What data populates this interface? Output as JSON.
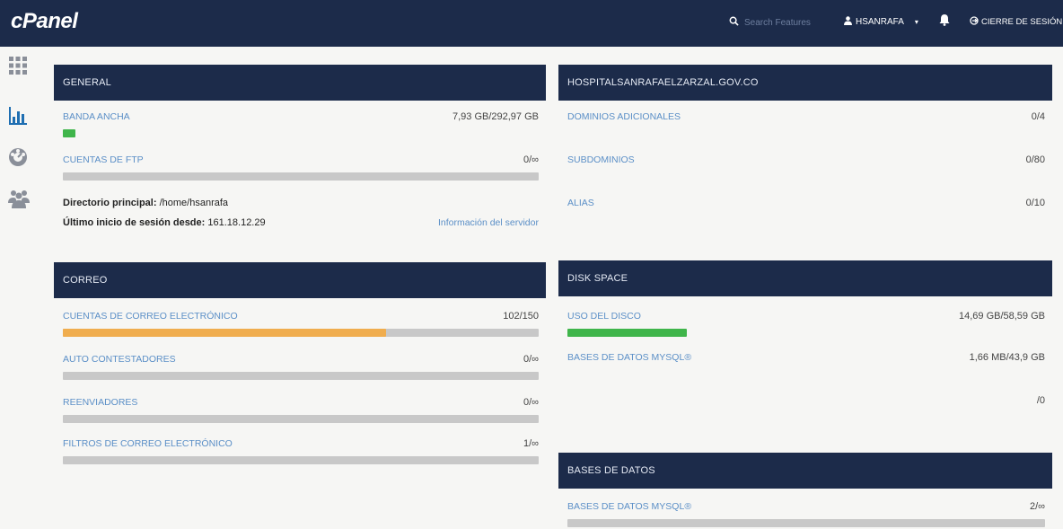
{
  "topbar": {
    "logo": "cPanel",
    "search_placeholder": "Search Features",
    "username": "HSANRAFA",
    "logout_label": "CIERRE DE SESIÓN"
  },
  "sidebar": {
    "items": [
      "apps-grid-icon",
      "stats-icon",
      "dashboard-icon",
      "users-icon"
    ]
  },
  "general": {
    "title": "GENERAL",
    "bandwidth_label": "BANDA ANCHA",
    "bandwidth_value": "7,93 GB/292,97 GB",
    "bandwidth_fill": 0.03,
    "ftp_label": "CUENTAS DE FTP",
    "ftp_value": "0/∞",
    "ftp_fill": 0,
    "home_dir_label": "Directorio principal:",
    "home_dir_value": "/home/hsanrafa",
    "last_login_label": "Último inicio de sesión desde:",
    "last_login_value": "161.18.12.29",
    "server_info_link": "Información del servidor"
  },
  "domain": {
    "title": "HOSPITALSANRAFAELZARZAL.GOV.CO",
    "rows": [
      {
        "label": "DOMINIOS ADICIONALES",
        "value": "0/4"
      },
      {
        "label": "SUBDOMINIOS",
        "value": "0/80"
      },
      {
        "label": "ALIAS",
        "value": "0/10"
      }
    ]
  },
  "mail": {
    "title": "CORREO",
    "rows": [
      {
        "label": "CUENTAS DE CORREO ELECTRÓNICO",
        "value": "102/150",
        "fill": 0.68,
        "color": "#f0ad4e"
      },
      {
        "label": "AUTO CONTESTADORES",
        "value": "0/∞",
        "fill": 0,
        "color": "#c8c8c8"
      },
      {
        "label": "REENVIADORES",
        "value": "0/∞",
        "fill": 0,
        "color": "#c8c8c8"
      },
      {
        "label": "FILTROS DE CORREO ELECTRÓNICO",
        "value": "1/∞",
        "fill": 0,
        "color": "#c8c8c8"
      }
    ]
  },
  "disk": {
    "title": "DISK SPACE",
    "rows": [
      {
        "label": "USO DEL DISCO",
        "value": "14,69 GB/58,59 GB",
        "fill": 0.25,
        "color": "#3fb54a"
      },
      {
        "label": "BASES DE DATOS MYSQL®",
        "value": "1,66 MB/43,9 GB"
      },
      {
        "label": "",
        "value": "/0"
      }
    ]
  },
  "databases": {
    "title": "BASES DE DATOS",
    "rows": [
      {
        "label": "BASES DE DATOS MYSQL®",
        "value": "2/∞",
        "fill": 0
      }
    ]
  },
  "colors": {
    "header": "#1c2b4a",
    "link": "#5b8fc7",
    "bandwidth_fill": "#3fb54a",
    "mail_fill": "#f0ad4e",
    "bar_bg": "#c8c8c8"
  }
}
